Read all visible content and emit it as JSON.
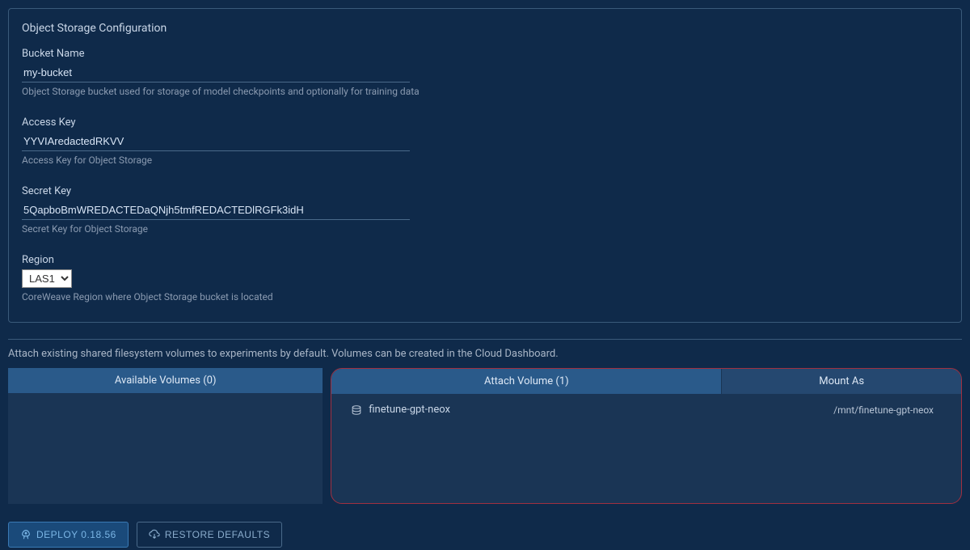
{
  "panel": {
    "title": "Object Storage Configuration",
    "bucket": {
      "label": "Bucket Name",
      "value": "my-bucket",
      "help": "Object Storage bucket used for storage of model checkpoints and optionally for training data"
    },
    "accessKey": {
      "label": "Access Key",
      "value": "YYVIAredactedRKVV",
      "help": "Access Key for Object Storage"
    },
    "secretKey": {
      "label": "Secret Key",
      "value": "5QapboBmWREDACTEDaQNjh5tmfREDACTEDlRGFk3idH",
      "help": "Secret Key for Object Storage"
    },
    "region": {
      "label": "Region",
      "value": "LAS1",
      "help": "CoreWeave Region where Object Storage bucket is located"
    }
  },
  "volumesDesc": "Attach existing shared filesystem volumes to experiments by default. Volumes can be created in the Cloud Dashboard.",
  "availableVolumes": {
    "header": "Available Volumes (0)"
  },
  "attachVolume": {
    "header": "Attach Volume (1)",
    "mountHeader": "Mount As",
    "items": [
      {
        "name": "finetune-gpt-neox",
        "mount": "/mnt/finetune-gpt-neox"
      }
    ]
  },
  "buttons": {
    "deploy": "DEPLOY 0.18.56",
    "restore": "RESTORE DEFAULTS"
  }
}
